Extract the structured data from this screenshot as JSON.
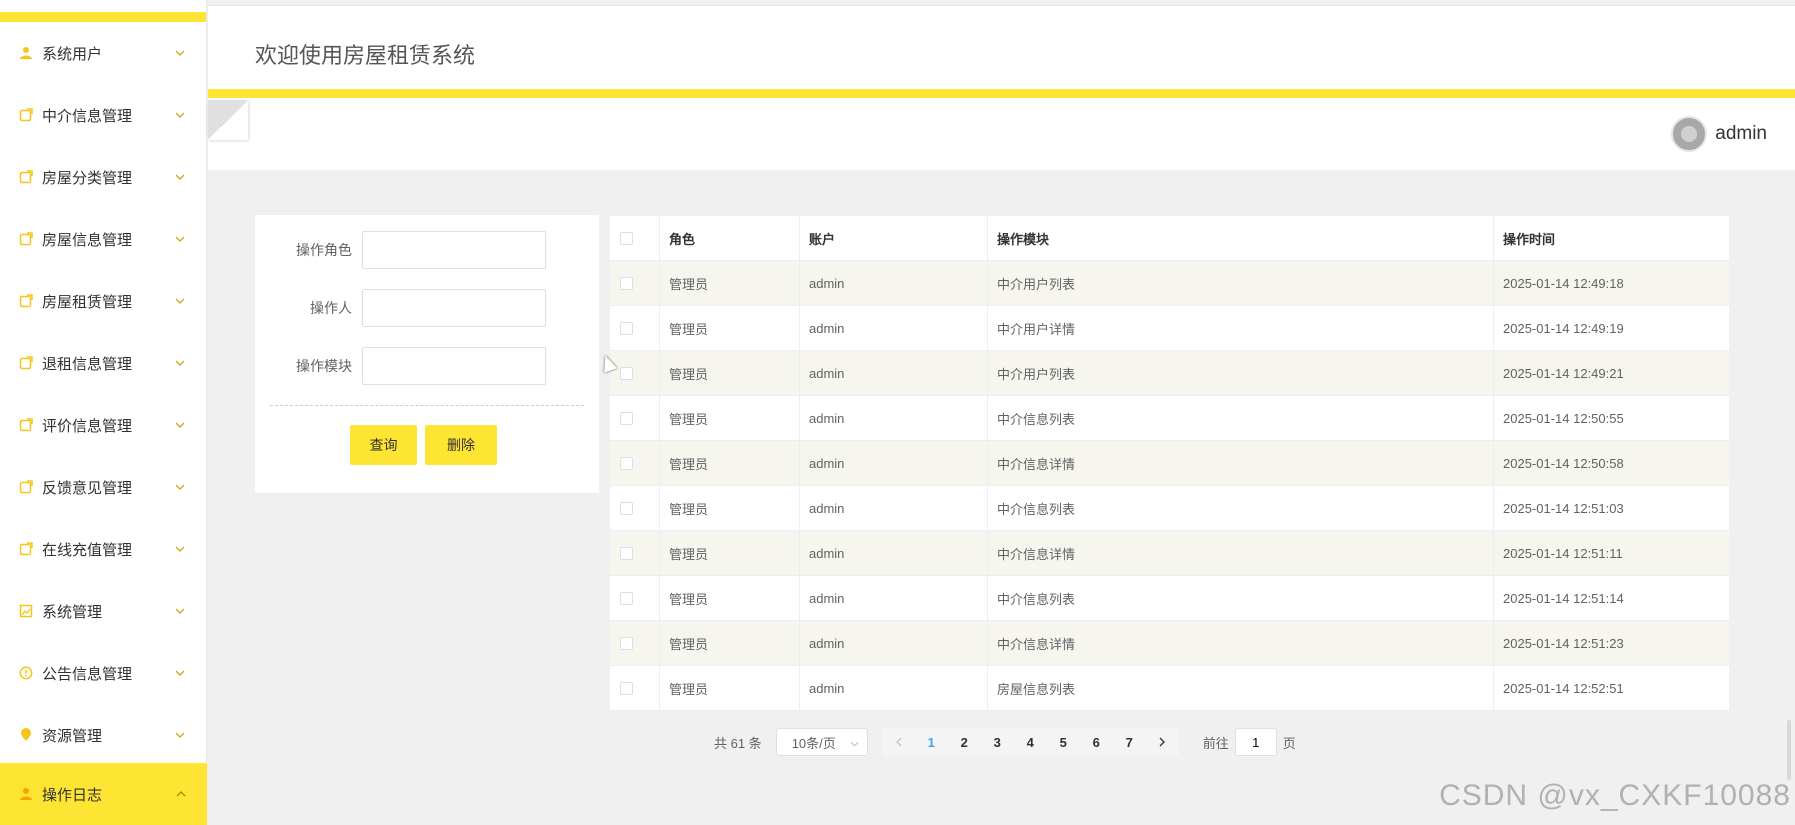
{
  "sidebar": {
    "items": [
      {
        "label": "系统用户",
        "icon": "user-icon"
      },
      {
        "label": "中介信息管理",
        "icon": "doc-icon"
      },
      {
        "label": "房屋分类管理",
        "icon": "doc-icon"
      },
      {
        "label": "房屋信息管理",
        "icon": "doc-icon"
      },
      {
        "label": "房屋租赁管理",
        "icon": "doc-icon"
      },
      {
        "label": "退租信息管理",
        "icon": "doc-icon"
      },
      {
        "label": "评价信息管理",
        "icon": "doc-icon"
      },
      {
        "label": "反馈意见管理",
        "icon": "doc-icon"
      },
      {
        "label": "在线充值管理",
        "icon": "doc-icon"
      },
      {
        "label": "系统管理",
        "icon": "picture-icon"
      },
      {
        "label": "公告信息管理",
        "icon": "warning-icon"
      },
      {
        "label": "资源管理",
        "icon": "location-icon"
      }
    ],
    "active": {
      "label": "操作日志",
      "icon": "user-icon"
    }
  },
  "header": {
    "title": "欢迎使用房屋租赁系统",
    "username": "admin"
  },
  "search": {
    "role_label": "操作角色",
    "operator_label": "操作人",
    "module_label": "操作模块",
    "query_button": "查询",
    "delete_button": "删除"
  },
  "table": {
    "columns": [
      "角色",
      "账户",
      "操作模块",
      "操作时间"
    ],
    "rows": [
      {
        "role": "管理员",
        "account": "admin",
        "module": "中介用户列表",
        "time": "2025-01-14 12:49:18"
      },
      {
        "role": "管理员",
        "account": "admin",
        "module": "中介用户详情",
        "time": "2025-01-14 12:49:19"
      },
      {
        "role": "管理员",
        "account": "admin",
        "module": "中介用户列表",
        "time": "2025-01-14 12:49:21"
      },
      {
        "role": "管理员",
        "account": "admin",
        "module": "中介信息列表",
        "time": "2025-01-14 12:50:55"
      },
      {
        "role": "管理员",
        "account": "admin",
        "module": "中介信息详情",
        "time": "2025-01-14 12:50:58"
      },
      {
        "role": "管理员",
        "account": "admin",
        "module": "中介信息列表",
        "time": "2025-01-14 12:51:03"
      },
      {
        "role": "管理员",
        "account": "admin",
        "module": "中介信息详情",
        "time": "2025-01-14 12:51:11"
      },
      {
        "role": "管理员",
        "account": "admin",
        "module": "中介信息列表",
        "time": "2025-01-14 12:51:14"
      },
      {
        "role": "管理员",
        "account": "admin",
        "module": "中介信息详情",
        "time": "2025-01-14 12:51:23"
      },
      {
        "role": "管理员",
        "account": "admin",
        "module": "房屋信息列表",
        "time": "2025-01-14 12:52:51"
      }
    ]
  },
  "pagination": {
    "total": "共 61 条",
    "page_size": "10条/页",
    "pages": [
      "1",
      "2",
      "3",
      "4",
      "5",
      "6",
      "7"
    ],
    "current": "1",
    "goto_prefix": "前往",
    "goto_value": "1",
    "goto_suffix": "页"
  },
  "watermark": "CSDN @vx_CXKF10088",
  "colors": {
    "accent": "#ffe533",
    "link": "#409eff"
  }
}
